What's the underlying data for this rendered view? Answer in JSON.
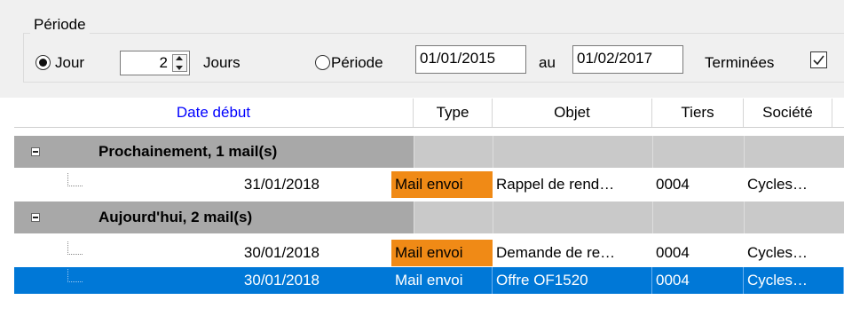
{
  "filter": {
    "group_title": "Période",
    "jour_label": "Jour",
    "days_value": "2",
    "days_unit": "Jours",
    "periode_label": "Période",
    "date_from": "01/01/2015",
    "au_label": "au",
    "date_to": "01/02/2017",
    "terminees_label": "Terminées",
    "terminees_checked": true
  },
  "grid": {
    "columns": [
      "Date début",
      "Type",
      "Objet",
      "Tiers",
      "Société"
    ],
    "groups": [
      {
        "title": "Prochainement, 1 mail(s)",
        "rows": [
          {
            "date": "31/01/2018",
            "type": "Mail envoi",
            "objet": "Rappel de rend…",
            "tiers": "0004",
            "societe": "Cycles…"
          }
        ]
      },
      {
        "title": "Aujourd'hui, 2 mail(s)",
        "rows": [
          {
            "date": "30/01/2018",
            "type": "Mail envoi",
            "objet": "Demande de re…",
            "tiers": "0004",
            "societe": "Cycles…"
          },
          {
            "date": "30/01/2018",
            "type": "Mail envoi",
            "objet": "Offre OF1520",
            "tiers": "0004",
            "societe": "Cycles…"
          }
        ]
      }
    ]
  },
  "colors": {
    "header_link": "#0000ff",
    "type_highlight": "#f08a16",
    "selection": "#0078d7",
    "group_band": "#a8a8a8"
  }
}
